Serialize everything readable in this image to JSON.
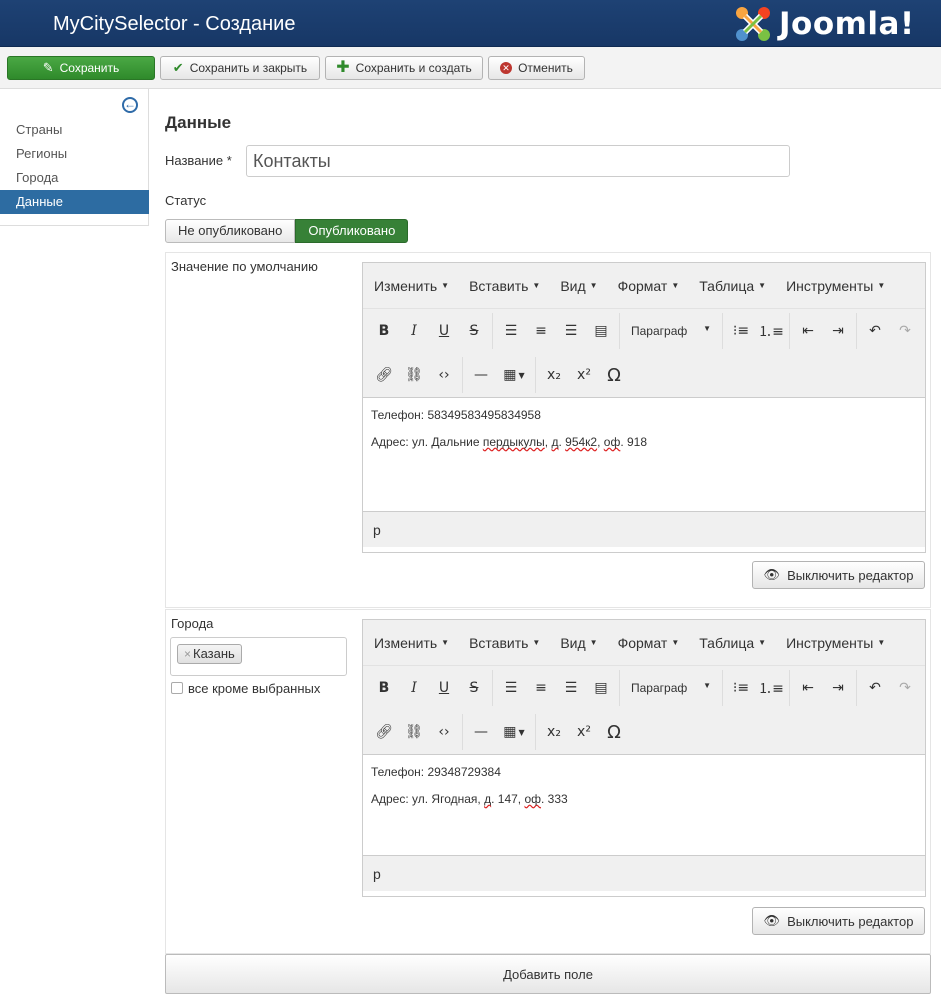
{
  "header": {
    "title": "MyCitySelector - Создание",
    "brand": "Joomla!"
  },
  "toolbar": {
    "save": "Сохранить",
    "save_close": "Сохранить и закрыть",
    "save_new": "Сохранить и создать",
    "cancel": "Отменить"
  },
  "sidebar": {
    "items": [
      {
        "label": "Страны"
      },
      {
        "label": "Регионы"
      },
      {
        "label": "Города"
      },
      {
        "label": "Данные",
        "active": true
      }
    ]
  },
  "form": {
    "section_title": "Данные",
    "name_label": "Название *",
    "name_value": "Контакты",
    "status_label": "Статус",
    "status_options": [
      "Не опубликовано",
      "Опубликовано"
    ],
    "status_selected": "Опубликовано",
    "default_value_label": "Значение по умолчанию",
    "cities_label": "Города",
    "city_chip": "Казань",
    "except_label": "все кроме выбранных",
    "add_field": "Добавить поле"
  },
  "editor": {
    "menus": [
      "Изменить",
      "Вставить",
      "Вид",
      "Формат",
      "Таблица",
      "Инструменты"
    ],
    "format_select": "Параграф",
    "path": "p",
    "toggle_label": "Выключить редактор"
  },
  "editor1": {
    "line1": "Телефон: 58349583495834958",
    "line2_a": "Адрес: ул. Дальние ",
    "line2_b": "пердыкулы",
    "line2_c": ", ",
    "line2_d": "д",
    "line2_e": ". ",
    "line2_f": "954к2",
    "line2_g": ", ",
    "line2_h": "оф",
    "line2_i": ". 918"
  },
  "editor2": {
    "line1": "Телефон: 29348729384",
    "line2_a": "Адрес: ул. Ягодная, ",
    "line2_b": "д",
    "line2_c": ". 147, ",
    "line2_d": "оф",
    "line2_e": ". 333"
  },
  "colors": {
    "header_bg": "#1e4274",
    "save_green": "#378137",
    "active_blue": "#2d6ca2"
  }
}
